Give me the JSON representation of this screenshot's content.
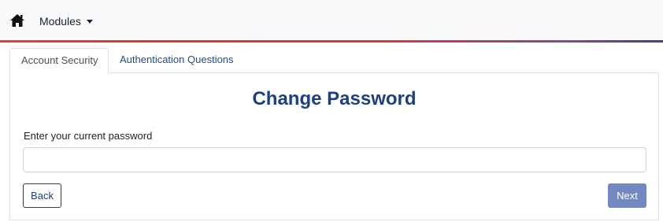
{
  "navbar": {
    "home_icon": "home-icon",
    "modules_label": "Modules",
    "caret_icon": "caret-down-icon",
    "accent_colors": [
      "#e33b2f",
      "#4b3c8c"
    ]
  },
  "tabs": [
    {
      "label": "Account Security",
      "active": true
    },
    {
      "label": "Authentication Questions",
      "active": false
    }
  ],
  "form": {
    "title": "Change Password",
    "field_label": "Enter your current password",
    "field_value": "",
    "back_label": "Back",
    "next_label": "Next"
  },
  "colors": {
    "primary": "#1f3f84",
    "next_button": "#7189c0",
    "navbar_bg": "#f8f9fa"
  }
}
